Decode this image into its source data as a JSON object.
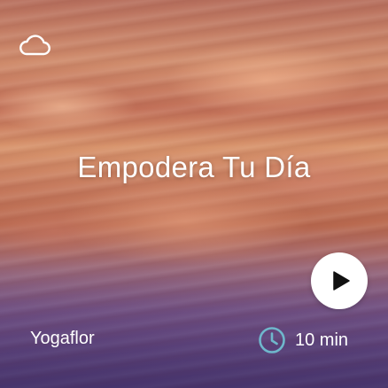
{
  "card": {
    "title": "Empodera Tu Día",
    "author": "Yogaflor",
    "duration": "10 min"
  },
  "icons": {
    "top_left": "cloud-icon",
    "action": "play-icon",
    "duration": "clock-icon"
  },
  "colors": {
    "text": "#ffffff",
    "play_button_bg": "#ffffff",
    "play_glyph": "#111111",
    "clock_accent": "#6fb7cc"
  }
}
